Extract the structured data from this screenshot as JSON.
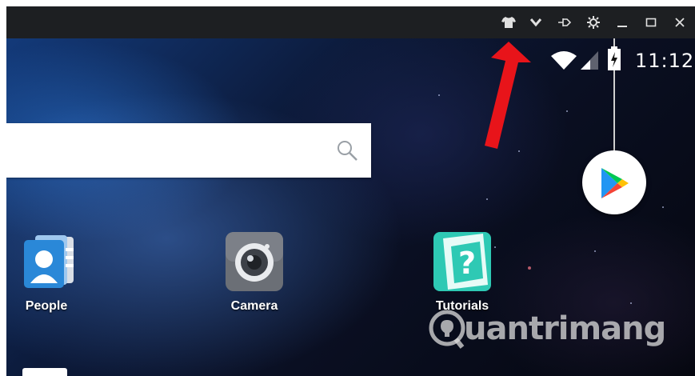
{
  "titlebar": {
    "buttons": [
      {
        "name": "skin-icon",
        "glyph": "👕"
      },
      {
        "name": "chevron-down-icon",
        "glyph": "⌄"
      },
      {
        "name": "pin-icon",
        "glyph": "⊣"
      },
      {
        "name": "gear-icon",
        "glyph": "⚙"
      },
      {
        "name": "minimize-icon",
        "glyph": "_"
      },
      {
        "name": "maximize-icon",
        "glyph": "☐"
      },
      {
        "name": "close-icon",
        "glyph": "✕"
      }
    ]
  },
  "statusbar": {
    "time": "11:12"
  },
  "apps": [
    {
      "label": "People"
    },
    {
      "label": "Camera"
    },
    {
      "label": "Tutorials"
    }
  ],
  "watermark": {
    "text": "uantrimang"
  },
  "colors": {
    "titlebar": "#1d1f22",
    "arrow": "#e8141a",
    "people_blue": "#2a88d8",
    "camera_gray": "#6b6f76",
    "tutorials_teal": "#2ec9b4",
    "play_green": "#00c853",
    "play_blue": "#2196f3",
    "play_red": "#f44336",
    "play_yellow": "#ffc107"
  }
}
